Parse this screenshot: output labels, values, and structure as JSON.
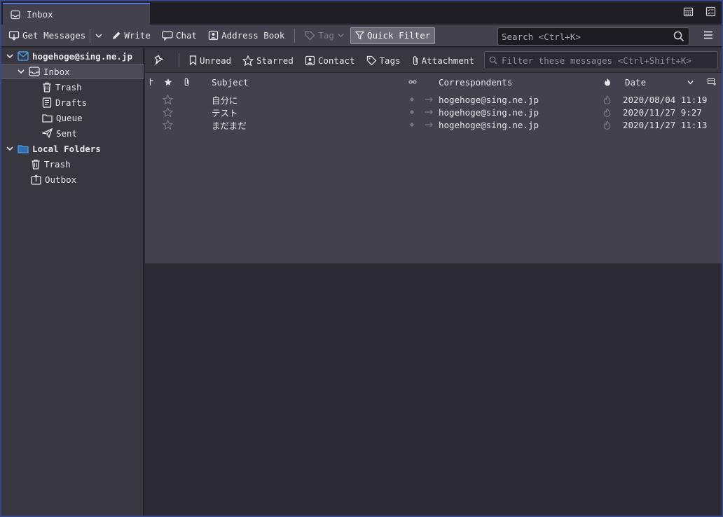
{
  "tab": {
    "title": "Inbox",
    "icon": "inbox-icon"
  },
  "tabbar_right": {
    "calendar_icon": "calendar-icon",
    "tasks_icon": "tasks-icon"
  },
  "toolbar": {
    "get_messages": "Get Messages",
    "write": "Write",
    "chat": "Chat",
    "address_book": "Address Book",
    "tag": "Tag",
    "quick_filter": "Quick Filter",
    "search_placeholder": "Search <Ctrl+K>"
  },
  "sidebar": {
    "account": "hogehoge@sing.ne.jp",
    "folders": [
      "Inbox",
      "Trash",
      "Drafts",
      "Queue",
      "Sent"
    ],
    "local_folders": "Local Folders",
    "local_items": [
      "Trash",
      "Outbox"
    ]
  },
  "quickfilter": {
    "unread": "Unread",
    "starred": "Starred",
    "contact": "Contact",
    "tags": "Tags",
    "attachment": "Attachment",
    "filter_placeholder": "Filter these messages <Ctrl+Shift+K>"
  },
  "columns": {
    "subject": "Subject",
    "correspondents": "Correspondents",
    "date": "Date"
  },
  "messages": [
    {
      "subject": "自分に",
      "correspondent": "hogehoge@sing.ne.jp",
      "date": "2020/08/04 11:19"
    },
    {
      "subject": "テスト",
      "correspondent": "hogehoge@sing.ne.jp",
      "date": "2020/11/27 9:27"
    },
    {
      "subject": "まだまだ",
      "correspondent": "hogehoge@sing.ne.jp",
      "date": "2020/11/27 11:13"
    }
  ],
  "colors": {
    "accent": "#5a78d6",
    "folder_blue": "#4aa3e8",
    "background": "#2b2a33",
    "pane": "#42414d"
  }
}
